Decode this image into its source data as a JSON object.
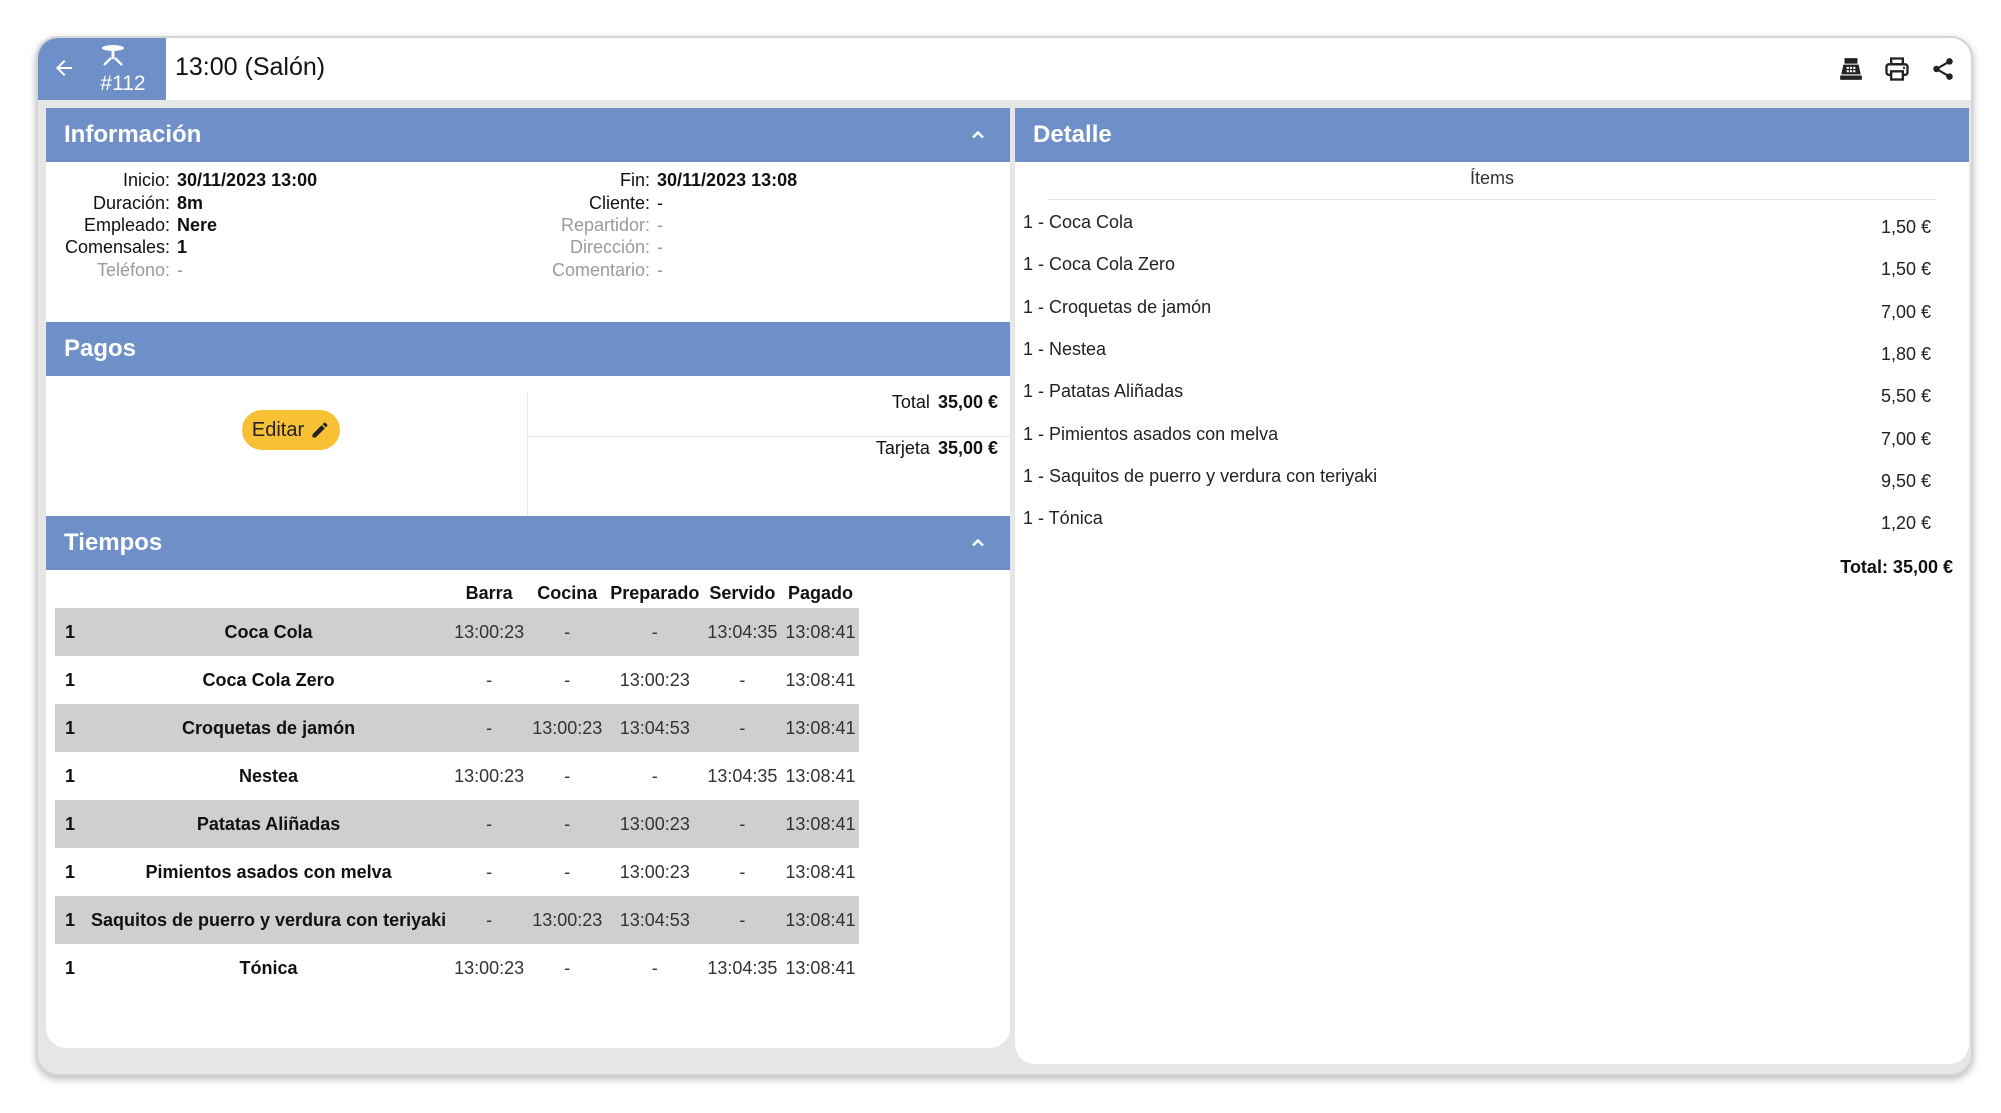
{
  "header": {
    "table_number": "#112",
    "title": "13:00 (Salón)",
    "icons": [
      "back-arrow-icon",
      "table-icon",
      "cash-register-icon",
      "printer-icon",
      "share-icon"
    ]
  },
  "info": {
    "heading": "Información",
    "left": [
      {
        "label": "Inicio:",
        "value": "30/11/2023 13:00"
      },
      {
        "label": "Duración:",
        "value": "8m"
      },
      {
        "label": "Empleado:",
        "value": "Nere"
      },
      {
        "label": "Comensales:",
        "value": "1"
      },
      {
        "label": "Teléfono:",
        "value": "-"
      }
    ],
    "right": [
      {
        "label": "Fin:",
        "value": "30/11/2023 13:08"
      },
      {
        "label": "Cliente:",
        "value": "-"
      },
      {
        "label": "Repartidor:",
        "value": "-"
      },
      {
        "label": "Dirección:",
        "value": "-"
      },
      {
        "label": "Comentario:",
        "value": "-"
      }
    ]
  },
  "payments": {
    "heading": "Pagos",
    "edit_label": "Editar",
    "total_label": "Total",
    "total_value": "35,00 €",
    "card_label": "Tarjeta",
    "card_value": "35,00 €"
  },
  "times": {
    "heading": "Tiempos",
    "columns": [
      "",
      "",
      "Barra",
      "Cocina",
      "Preparado",
      "Servido",
      "Pagado"
    ],
    "rows": [
      [
        "1",
        "Coca Cola",
        "13:00:23",
        "-",
        "-",
        "13:04:35",
        "13:08:41"
      ],
      [
        "1",
        "Coca Cola Zero",
        "-",
        "-",
        "13:00:23",
        "-",
        "13:08:41"
      ],
      [
        "1",
        "Croquetas de jamón",
        "-",
        "13:00:23",
        "13:04:53",
        "-",
        "13:08:41"
      ],
      [
        "1",
        "Nestea",
        "13:00:23",
        "-",
        "-",
        "13:04:35",
        "13:08:41"
      ],
      [
        "1",
        "Patatas Aliñadas",
        "-",
        "-",
        "13:00:23",
        "-",
        "13:08:41"
      ],
      [
        "1",
        "Pimientos asados con melva",
        "-",
        "-",
        "13:00:23",
        "-",
        "13:08:41"
      ],
      [
        "1",
        "Saquitos de puerro y verdura con teriyaki",
        "-",
        "13:00:23",
        "13:04:53",
        "-",
        "13:08:41"
      ],
      [
        "1",
        "Tónica",
        "13:00:23",
        "-",
        "-",
        "13:04:35",
        "13:08:41"
      ]
    ]
  },
  "detail": {
    "heading": "Detalle",
    "items_header": "Ítems",
    "items": [
      {
        "name": "1 - Coca Cola",
        "price": "1,50 €"
      },
      {
        "name": "1 - Coca Cola Zero",
        "price": "1,50 €"
      },
      {
        "name": "1 - Croquetas de jamón",
        "price": "7,00 €"
      },
      {
        "name": "1 - Nestea",
        "price": "1,80 €"
      },
      {
        "name": "1 - Patatas Aliñadas",
        "price": "5,50 €"
      },
      {
        "name": "1 - Pimientos asados con melva",
        "price": "7,00 €"
      },
      {
        "name": "1 - Saquitos de puerro y verdura con teriyaki",
        "price": "9,50 €"
      },
      {
        "name": "1 - Tónica",
        "price": "1,20 €"
      }
    ],
    "total": "Total: 35,00 €"
  },
  "colors": {
    "accent": "#6e8fc8",
    "edit_button": "#f8c035",
    "row_alt": "#cfcfcf"
  }
}
